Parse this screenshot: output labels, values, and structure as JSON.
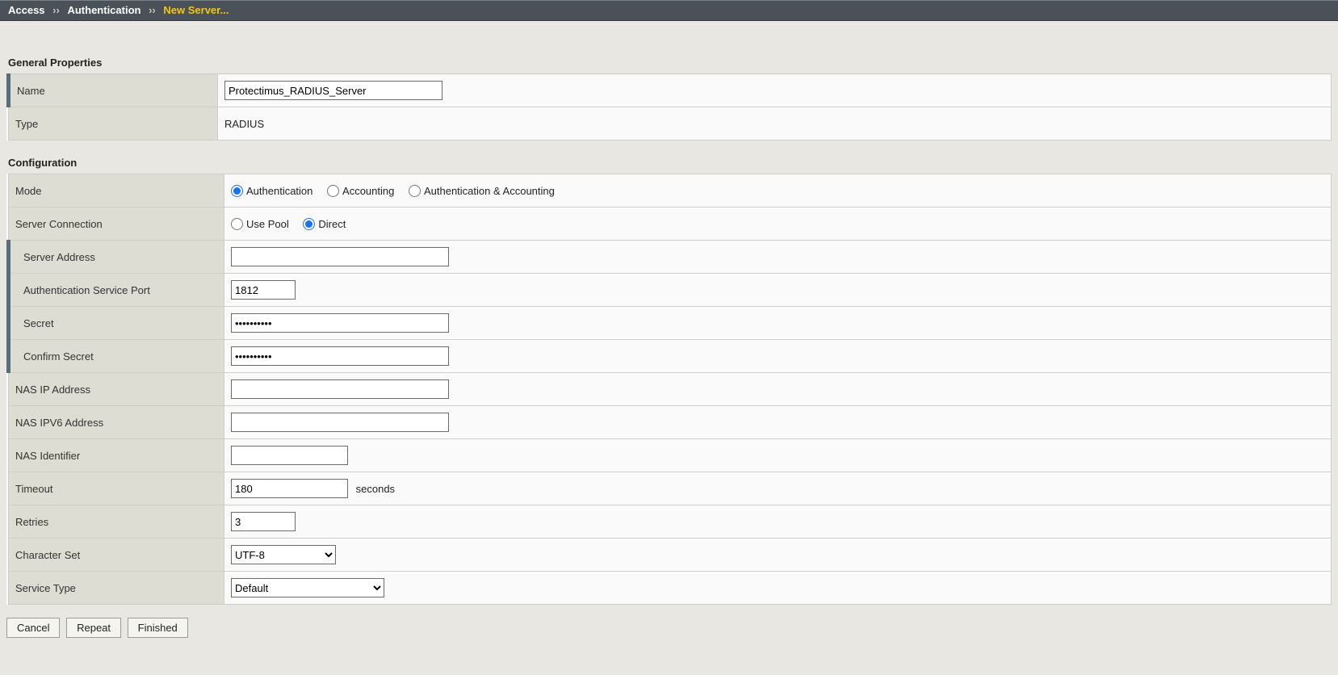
{
  "breadcrumb": {
    "part1": "Access",
    "sep": "››",
    "part2": "Authentication",
    "part3": "New Server..."
  },
  "sections": {
    "general": "General Properties",
    "config": "Configuration"
  },
  "general": {
    "name_label": "Name",
    "name_value": "Protectimus_RADIUS_Server",
    "type_label": "Type",
    "type_value": "RADIUS"
  },
  "config": {
    "mode_label": "Mode",
    "mode_opts": {
      "auth": "Authentication",
      "acct": "Accounting",
      "both": "Authentication & Accounting"
    },
    "conn_label": "Server Connection",
    "conn_opts": {
      "pool": "Use Pool",
      "direct": "Direct"
    },
    "server_addr_label": "Server Address",
    "server_addr_value": "",
    "auth_port_label": "Authentication Service Port",
    "auth_port_value": "1812",
    "secret_label": "Secret",
    "secret_value": "••••••••••",
    "confirm_secret_label": "Confirm Secret",
    "confirm_secret_value": "••••••••••",
    "nas_ip_label": "NAS IP Address",
    "nas_ip_value": "",
    "nas_ipv6_label": "NAS IPV6 Address",
    "nas_ipv6_value": "",
    "nas_id_label": "NAS Identifier",
    "nas_id_value": "",
    "timeout_label": "Timeout",
    "timeout_value": "180",
    "timeout_unit": "seconds",
    "retries_label": "Retries",
    "retries_value": "3",
    "charset_label": "Character Set",
    "charset_value": "UTF-8",
    "service_type_label": "Service Type",
    "service_type_value": "Default"
  },
  "buttons": {
    "cancel": "Cancel",
    "repeat": "Repeat",
    "finished": "Finished"
  }
}
